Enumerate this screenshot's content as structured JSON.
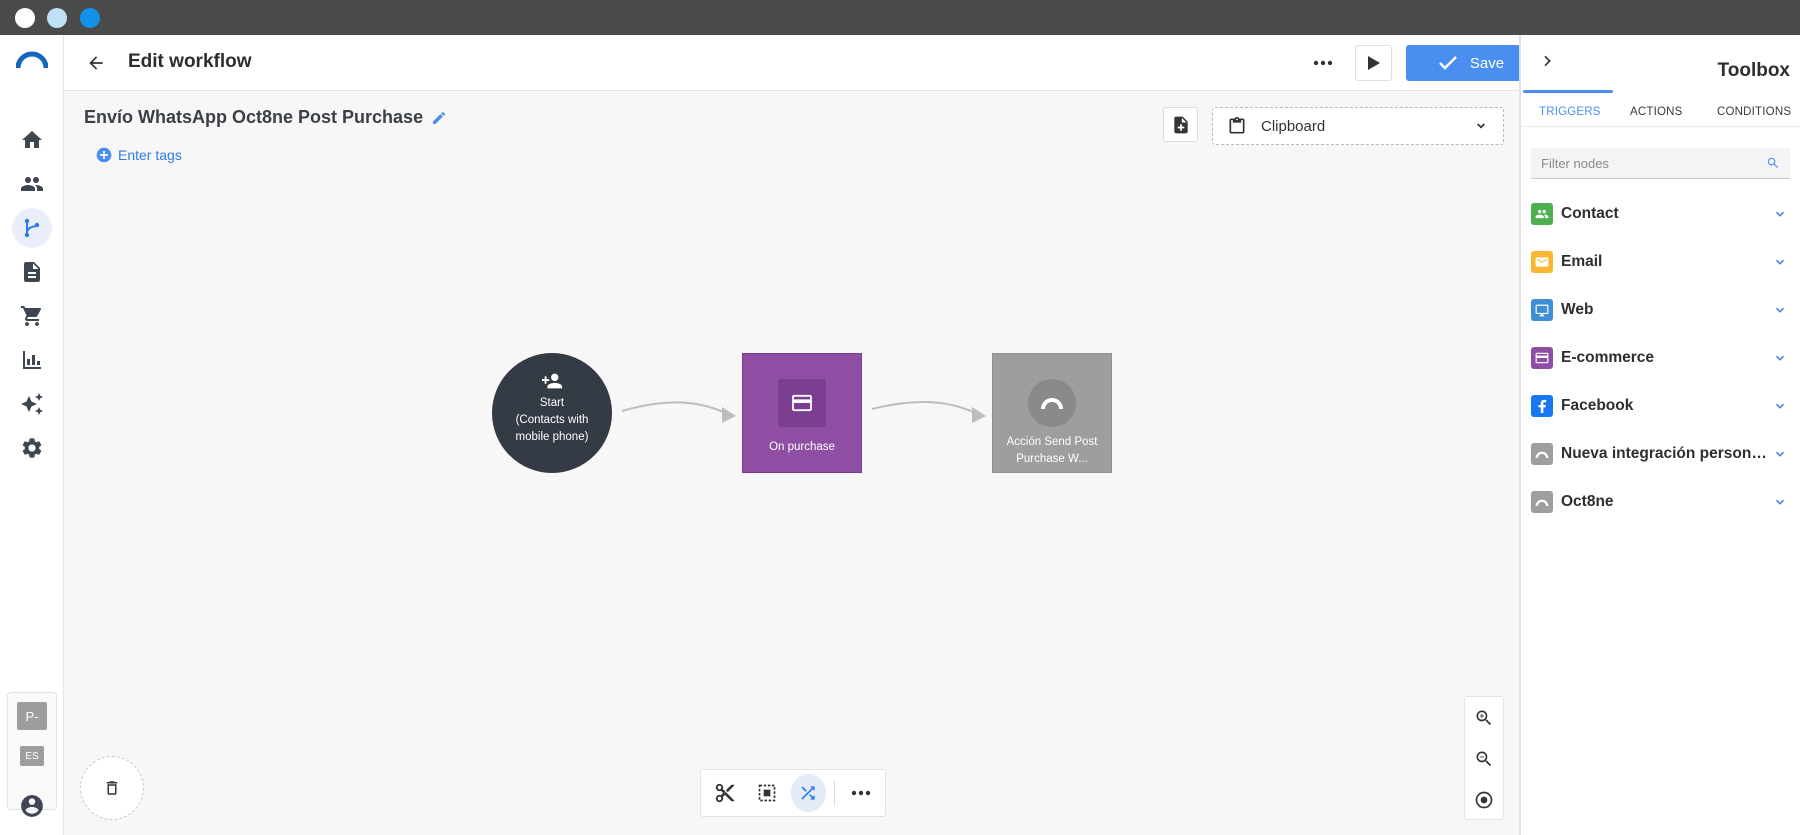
{
  "app": {
    "window_controls": [
      "close",
      "minimize",
      "maximize"
    ]
  },
  "header": {
    "title": "Edit workflow",
    "save_label": "Save"
  },
  "workflow": {
    "name": "Envío WhatsApp Oct8ne Post Purchase",
    "tags_placeholder": "Enter tags",
    "clipboard_label": "Clipboard"
  },
  "nodes": {
    "start": {
      "line1": "Start",
      "line2": "(Contacts with",
      "line3": "mobile phone)"
    },
    "purchase": {
      "label": "On purchase"
    },
    "action": {
      "line1": "Acción Send Post",
      "line2": "Purchase W..."
    }
  },
  "rail": {
    "account_badge": "P-",
    "language_badge": "ES"
  },
  "toolbox": {
    "title": "Toolbox",
    "tabs": [
      "TRIGGERS",
      "ACTIONS",
      "CONDITIONS"
    ],
    "active_tab": "TRIGGERS",
    "filter_placeholder": "Filter nodes",
    "categories": [
      {
        "name": "Contact",
        "icon": "people-icon",
        "color": "#4caf50"
      },
      {
        "name": "Email",
        "icon": "mail-icon",
        "color": "#f9b731"
      },
      {
        "name": "Web",
        "icon": "monitor-icon",
        "color": "#3f8fd6"
      },
      {
        "name": "E-commerce",
        "icon": "card-icon",
        "color": "#8e4ea3"
      },
      {
        "name": "Facebook",
        "icon": "facebook-icon",
        "color": "#1877f2"
      },
      {
        "name": "Nueva integración personalizada",
        "icon": "integration-icon",
        "color": "#9e9e9e"
      },
      {
        "name": "Oct8ne",
        "icon": "integration-icon",
        "color": "#9e9e9e"
      }
    ]
  },
  "colors": {
    "accent": "#4a8ff0",
    "start_node": "#353b44",
    "purchase_node": "#8e4ea3",
    "action_node": "#9e9e9e"
  }
}
